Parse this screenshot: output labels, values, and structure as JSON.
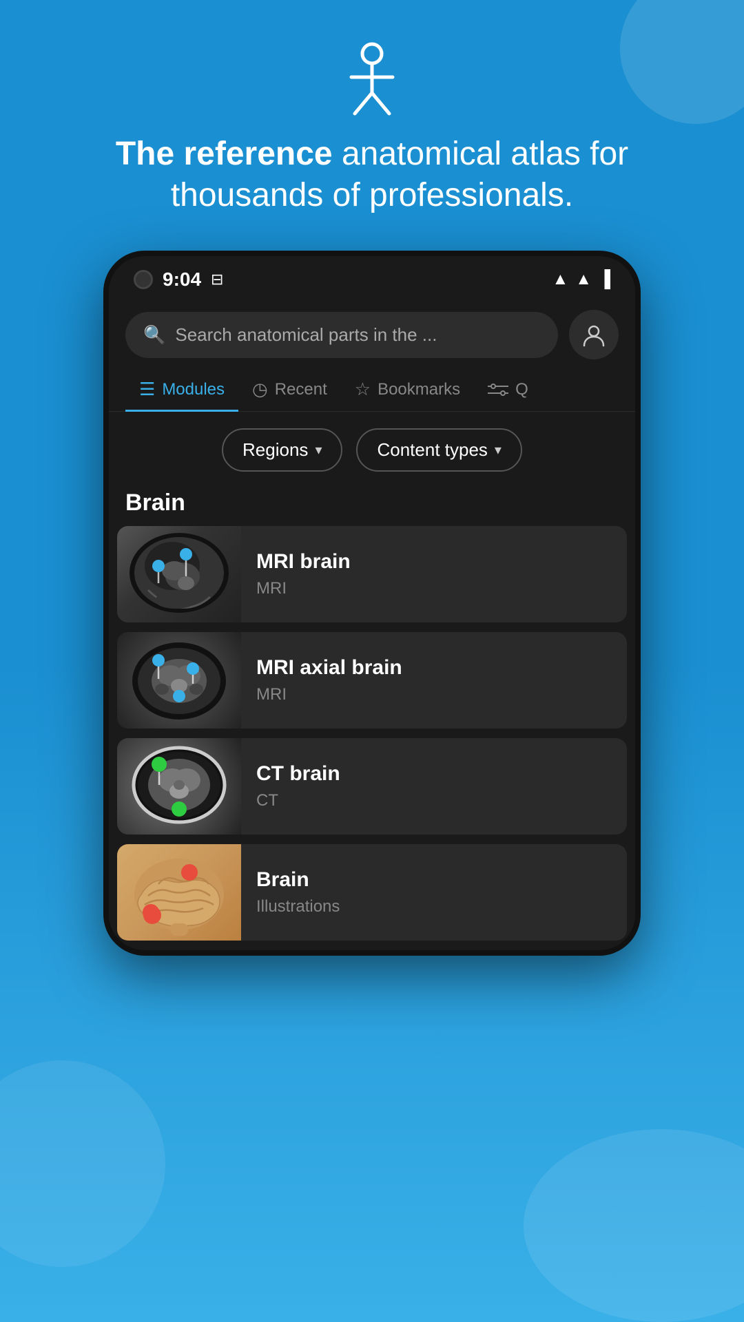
{
  "background": {
    "color": "#1a8fd1"
  },
  "header": {
    "tagline_bold": "The reference",
    "tagline_rest": " anatomical atlas for thousands of professionals.",
    "icon": "person-icon"
  },
  "status_bar": {
    "time": "9:04",
    "camera": true
  },
  "search": {
    "placeholder": "Search anatomical parts in the ..."
  },
  "tabs": [
    {
      "id": "modules",
      "label": "Modules",
      "active": true
    },
    {
      "id": "recent",
      "label": "Recent",
      "active": false
    },
    {
      "id": "bookmarks",
      "label": "Bookmarks",
      "active": false
    },
    {
      "id": "filter",
      "label": "Q",
      "active": false
    }
  ],
  "filters": [
    {
      "id": "regions",
      "label": "Regions"
    },
    {
      "id": "content-types",
      "label": "Content types"
    }
  ],
  "section": {
    "title": "Brain"
  },
  "modules": [
    {
      "id": "mri-brain",
      "name": "MRI brain",
      "type": "MRI",
      "thumb": "mri1"
    },
    {
      "id": "mri-axial-brain",
      "name": "MRI axial brain",
      "type": "MRI",
      "thumb": "mri2"
    },
    {
      "id": "ct-brain",
      "name": "CT brain",
      "type": "CT",
      "thumb": "ct"
    },
    {
      "id": "brain",
      "name": "Brain",
      "type": "Illustrations",
      "thumb": "brain"
    }
  ]
}
